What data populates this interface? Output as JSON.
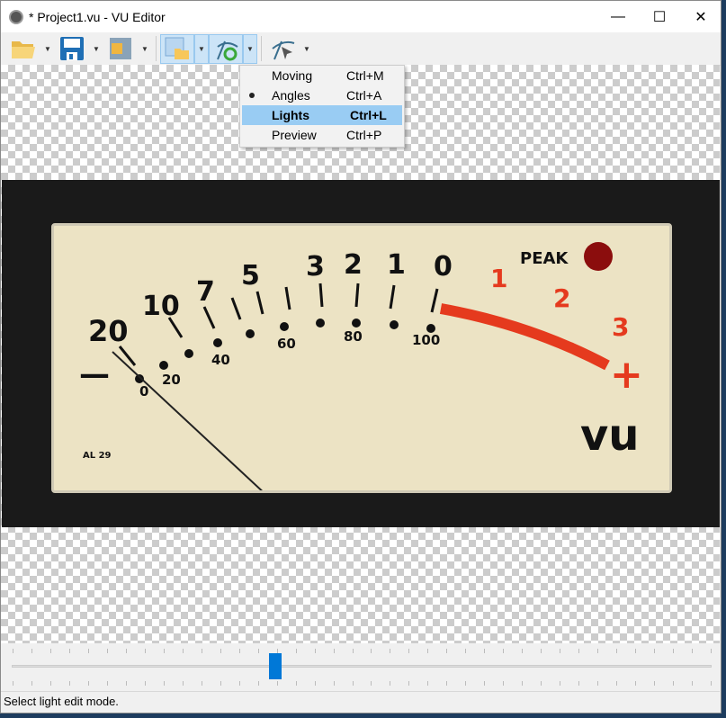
{
  "window": {
    "title": "* Project1.vu - VU Editor",
    "minimize": "—",
    "maximize": "☐",
    "close": "✕"
  },
  "toolbar": {
    "buttons": [
      {
        "icon": "open-folder-icon"
      },
      {
        "icon": "save-icon"
      },
      {
        "icon": "compress-icon"
      },
      {
        "icon": "background-open-icon",
        "active": true
      },
      {
        "icon": "angles-mode-icon",
        "active": true
      },
      {
        "icon": "needle-icon"
      }
    ]
  },
  "menu": {
    "items": [
      {
        "label": "Moving",
        "shortcut": "Ctrl+M"
      },
      {
        "label": "Angles",
        "shortcut": "Ctrl+A",
        "checked": true
      },
      {
        "label": "Lights",
        "shortcut": "Ctrl+L",
        "highlighted": true
      },
      {
        "label": "Preview",
        "shortcut": "Ctrl+P"
      }
    ]
  },
  "meter": {
    "db_labels": [
      "20",
      "10",
      "7",
      "5",
      "3",
      "2",
      "1",
      "0",
      "1",
      "2",
      "3"
    ],
    "percent_labels": [
      "0",
      "20",
      "40",
      "60",
      "80",
      "100"
    ],
    "peak": "PEAK",
    "vu": "vu",
    "model": "AL 29",
    "minus": "—",
    "plus": "+"
  },
  "slider": {
    "value": 0.376,
    "ticks": 38
  },
  "status": {
    "text": "Select light edit mode."
  },
  "colors": {
    "accent": "#0078d7",
    "highlight": "#99ccf3",
    "meter_red": "#e53a1e"
  }
}
